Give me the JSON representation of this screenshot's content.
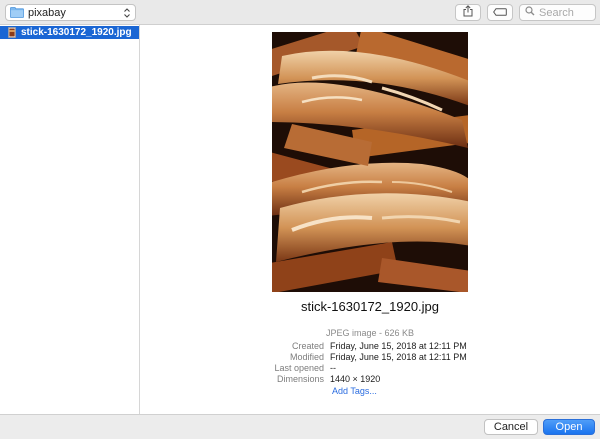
{
  "toolbar": {
    "location": "pixabay",
    "search_placeholder": "Search",
    "location_icon": "folder-icon",
    "share_icon": "share-icon",
    "tag_icon": "tag-icon",
    "search_icon": "magnifier-icon"
  },
  "file_list": {
    "items": [
      {
        "name": "stick-1630172_1920.jpg",
        "selected": true,
        "icon": "image-file-icon"
      }
    ]
  },
  "preview": {
    "title": "stick-1630172_1920.jpg",
    "kind": "JPEG image - 626 KB",
    "details": [
      {
        "label": "Created",
        "value": "Friday, June 15, 2018 at 12:11 PM"
      },
      {
        "label": "Modified",
        "value": "Friday, June 15, 2018 at 12:11 PM"
      },
      {
        "label": "Last opened",
        "value": "--"
      },
      {
        "label": "Dimensions",
        "value": "1440 × 1920"
      }
    ],
    "add_tags": "Add Tags..."
  },
  "buttons": {
    "cancel": "Cancel",
    "open": "Open"
  },
  "colors": {
    "selection": "#1a66d4",
    "primary_button": "#1a74ef",
    "link": "#2a6ce0"
  }
}
